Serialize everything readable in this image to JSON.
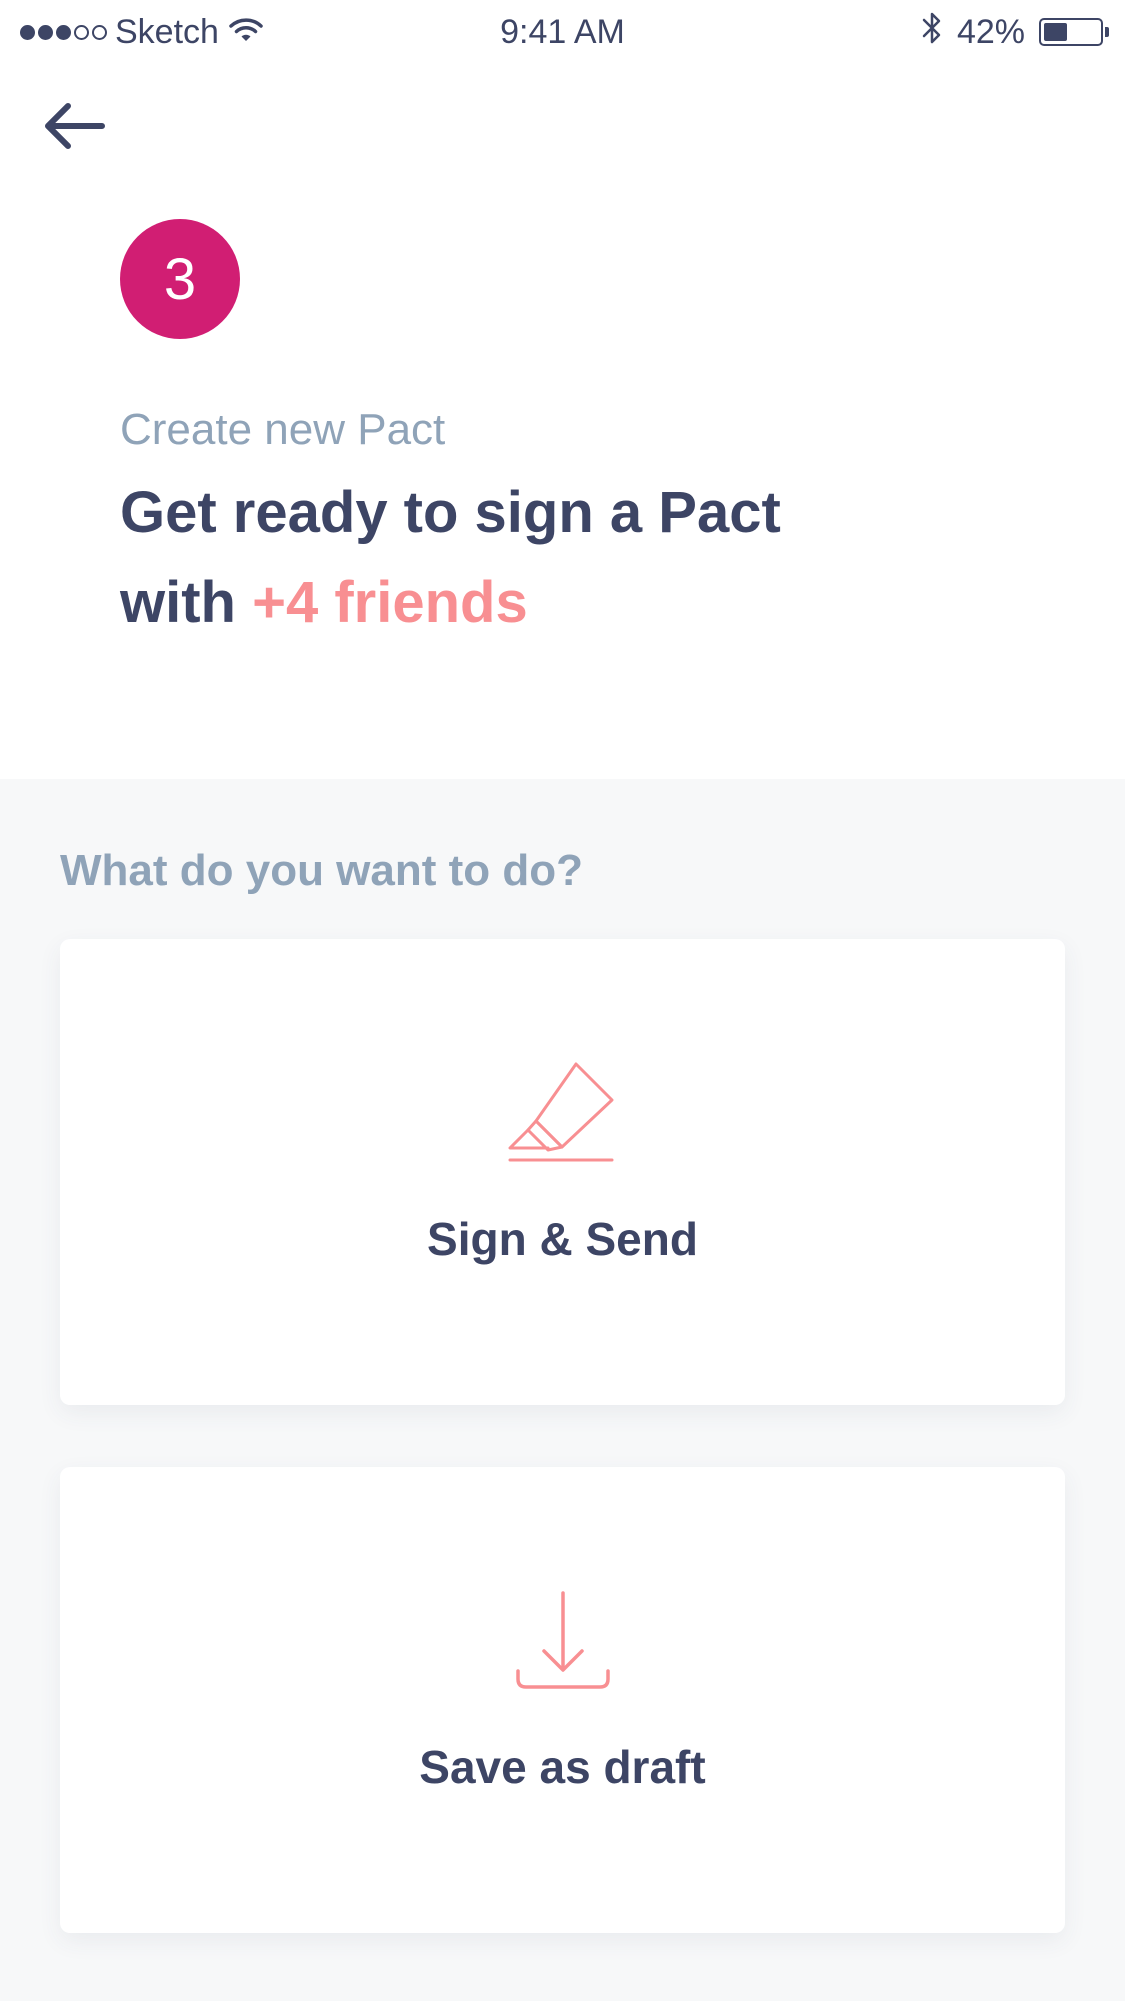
{
  "status_bar": {
    "carrier": "Sketch",
    "time": "9:41 AM",
    "battery_percent": "42%",
    "battery_level": 0.42,
    "signal_bars_filled": 3,
    "signal_bars_total": 5
  },
  "header": {
    "step_number": "3",
    "subtitle": "Create new Pact",
    "headline_line1": "Get ready to sign a Pact",
    "headline_with": "with",
    "headline_highlight": "+4 friends"
  },
  "options": {
    "question": "What do you want to do?",
    "sign_send_label": "Sign & Send",
    "save_draft_label": "Save as draft"
  },
  "colors": {
    "accent": "#d11e73",
    "highlight": "#f88f92",
    "text_primary": "#3d4565",
    "text_muted": "#8fa3b8",
    "section_bg": "#f7f8f9"
  },
  "icons": {
    "back": "arrow-left-icon",
    "sign": "highlighter-icon",
    "draft": "download-tray-icon",
    "bluetooth": "bluetooth-icon",
    "wifi": "wifi-icon",
    "battery": "battery-icon"
  }
}
